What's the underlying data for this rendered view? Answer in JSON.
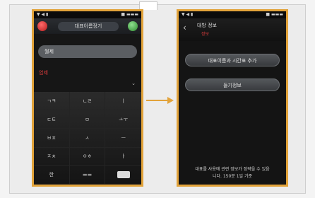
{
  "left_phone": {
    "status_left": "▼ ◀ ▮",
    "status_right": "■ ▬▬▬",
    "title": "대표이름정기",
    "input_value": "월제",
    "red_text": "업제",
    "chevron": "⌄",
    "keys": [
      "ㄱㅋ",
      "ㄴㄹ",
      "ㅣ",
      "ㄷㅌ",
      "ㅁ",
      "ㅗㅜ",
      "ㅂㅍ",
      "ㅅ",
      "ㅡ",
      "ㅈㅊ",
      "ㅇㅎ",
      "ㅏ",
      "한",
      "",
      ""
    ]
  },
  "right_phone": {
    "status_left": "▼ ◀ ▮",
    "status_right": "■ ▬▬▬",
    "back": "‹",
    "title": "대방 정보",
    "subtitle": "정보",
    "button_one": "대표이름과 시간표 추가",
    "button_two": "들기정보",
    "footer_line1": "대표를 사용에 관련 정보가 정략을 수 있음",
    "footer_line2": "니다. 150분 1일 기준"
  }
}
